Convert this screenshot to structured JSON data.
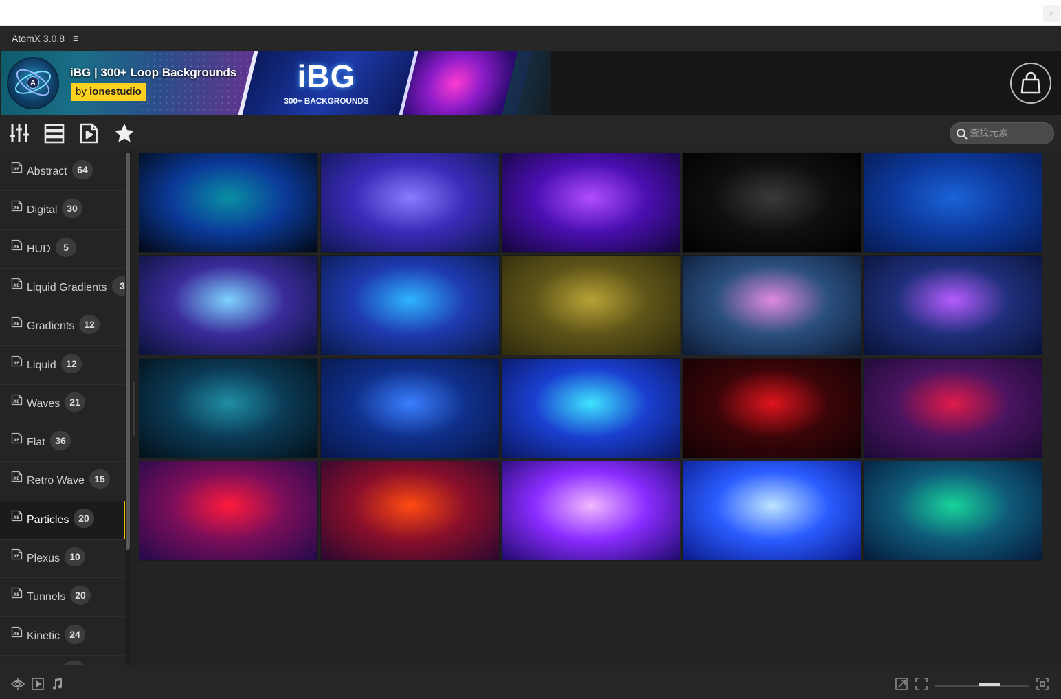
{
  "window": {
    "close_glyph": "×"
  },
  "app": {
    "title": "AtomX 3.0.8",
    "menu_glyph": "≡"
  },
  "banner": {
    "logo_letter": "A",
    "title": "iBG | 300+ Loop Backgrounds",
    "by_prefix": "by ",
    "author": "ionestudio",
    "art_big": "iBG",
    "art_small": "300+ BACKGROUNDS",
    "store_icon": "shopping-bag-icon"
  },
  "toolbar": {
    "icons": [
      "sliders-icon",
      "list-view-icon",
      "video-file-icon",
      "star-icon"
    ],
    "search": {
      "placeholder": "查找元素",
      "value": ""
    }
  },
  "sidebar": {
    "active_label": "Particles",
    "accent_color": "#f2c200",
    "categories": [
      {
        "label": "Abstract",
        "count": "64"
      },
      {
        "label": "Digital",
        "count": "30"
      },
      {
        "label": "HUD",
        "count": "5"
      },
      {
        "label": "Liquid Gradients",
        "count": "3"
      },
      {
        "label": "Gradients",
        "count": "12"
      },
      {
        "label": "Liquid",
        "count": "12"
      },
      {
        "label": "Waves",
        "count": "21"
      },
      {
        "label": "Flat",
        "count": "36"
      },
      {
        "label": "Retro Wave",
        "count": "15"
      },
      {
        "label": "Particles",
        "count": "20"
      },
      {
        "label": "Plexus",
        "count": "10"
      },
      {
        "label": "Tunnels",
        "count": "20"
      },
      {
        "label": "Kinetic",
        "count": "24"
      }
    ]
  },
  "thumbnails": [
    {
      "name": "teal-cloud",
      "colors": [
        "#0a8fa3",
        "#0b3a9a",
        "#020814"
      ]
    },
    {
      "name": "violet-cloud",
      "colors": [
        "#8a7cff",
        "#3a2bb8",
        "#0f1650"
      ]
    },
    {
      "name": "purple-warp",
      "colors": [
        "#b04dff",
        "#4a0fb0",
        "#12063a"
      ]
    },
    {
      "name": "star-field",
      "colors": [
        "#3a3a3a",
        "#101010",
        "#000000"
      ]
    },
    {
      "name": "blue-glow",
      "colors": [
        "#1a63d8",
        "#0d3a9e",
        "#061a52"
      ]
    },
    {
      "name": "particle-terrain",
      "colors": [
        "#7fd3ff",
        "#3a2b9a",
        "#0a1236"
      ]
    },
    {
      "name": "blue-dust",
      "colors": [
        "#2fb4ff",
        "#1e3ab0",
        "#0a1a4a"
      ]
    },
    {
      "name": "gold-dust",
      "colors": [
        "#b8a336",
        "#5e5418",
        "#2e2a0c"
      ]
    },
    {
      "name": "pink-waves",
      "colors": [
        "#e08adf",
        "#2a4f7e",
        "#0c1a36"
      ]
    },
    {
      "name": "purple-waves",
      "colors": [
        "#b65cff",
        "#1e2f7a",
        "#081238"
      ]
    },
    {
      "name": "teal-nebula",
      "colors": [
        "#1f8ea5",
        "#0b3a55",
        "#031019"
      ]
    },
    {
      "name": "blue-rain",
      "colors": [
        "#3a7fff",
        "#0f2f8a",
        "#071648"
      ]
    },
    {
      "name": "particle-sphere",
      "colors": [
        "#3ee4ff",
        "#1a3fd0",
        "#0a1660"
      ]
    },
    {
      "name": "red-smoke",
      "colors": [
        "#e0141e",
        "#3a0508",
        "#120204"
      ]
    },
    {
      "name": "red-burst",
      "colors": [
        "#e01a4a",
        "#4a1460",
        "#1a0a34"
      ]
    },
    {
      "name": "crimson-streaks",
      "colors": [
        "#ff1a3c",
        "#7a0e5a",
        "#220a4a"
      ]
    },
    {
      "name": "orange-swirl",
      "colors": [
        "#ff4a10",
        "#8a0f2a",
        "#2a0830"
      ]
    },
    {
      "name": "purple-spiral",
      "colors": [
        "#f0b8ff",
        "#8a2cff",
        "#1e0a6a"
      ]
    },
    {
      "name": "blue-spiral",
      "colors": [
        "#bfe4ff",
        "#2a5cff",
        "#0a1a8a"
      ]
    },
    {
      "name": "teal-warp",
      "colors": [
        "#18d49a",
        "#0f5a7a",
        "#061a3a"
      ]
    }
  ],
  "statusbar": {
    "left_icons": [
      "eye-icon",
      "play-icon",
      "music-icon"
    ],
    "right_icons": [
      "external-link-icon",
      "fit-icon",
      "fullscreen-icon"
    ],
    "zoom_slider": 0.55
  }
}
